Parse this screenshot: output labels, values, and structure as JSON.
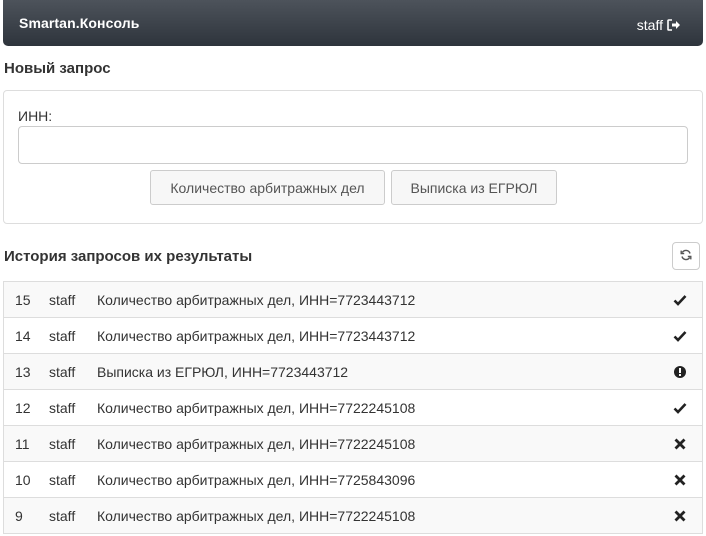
{
  "navbar": {
    "brand": "Smartan.Консоль",
    "username": "staff",
    "logout_icon": "sign-out-icon"
  },
  "new_request": {
    "title": "Новый запрос",
    "inn_label": "ИНН:",
    "inn_value": "",
    "inn_placeholder": "",
    "button_arbitration": "Количество арбитражных дел",
    "button_egrul": "Выписка из ЕГРЮЛ"
  },
  "history": {
    "title": "История запросов их результаты",
    "refresh_icon": "refresh-icon",
    "rows": [
      {
        "id": "15",
        "user": "staff",
        "description": "Количество арбитражных дел, ИНН=7723443712",
        "status": "ok"
      },
      {
        "id": "14",
        "user": "staff",
        "description": "Количество арбитражных дел, ИНН=7723443712",
        "status": "ok"
      },
      {
        "id": "13",
        "user": "staff",
        "description": "Выписка из ЕГРЮЛ, ИНН=7723443712",
        "status": "warning"
      },
      {
        "id": "12",
        "user": "staff",
        "description": "Количество арбитражных дел, ИНН=7722245108",
        "status": "ok"
      },
      {
        "id": "11",
        "user": "staff",
        "description": "Количество арбитражных дел, ИНН=7722245108",
        "status": "error"
      },
      {
        "id": "10",
        "user": "staff",
        "description": "Количество арбитражных дел, ИНН=7725843096",
        "status": "error"
      },
      {
        "id": "9",
        "user": "staff",
        "description": "Количество арбитражных дел, ИНН=7722245108",
        "status": "error"
      }
    ]
  },
  "colors": {
    "navbar_top": "#4d535b",
    "navbar_bottom": "#2e343c",
    "icon": "#222222"
  }
}
